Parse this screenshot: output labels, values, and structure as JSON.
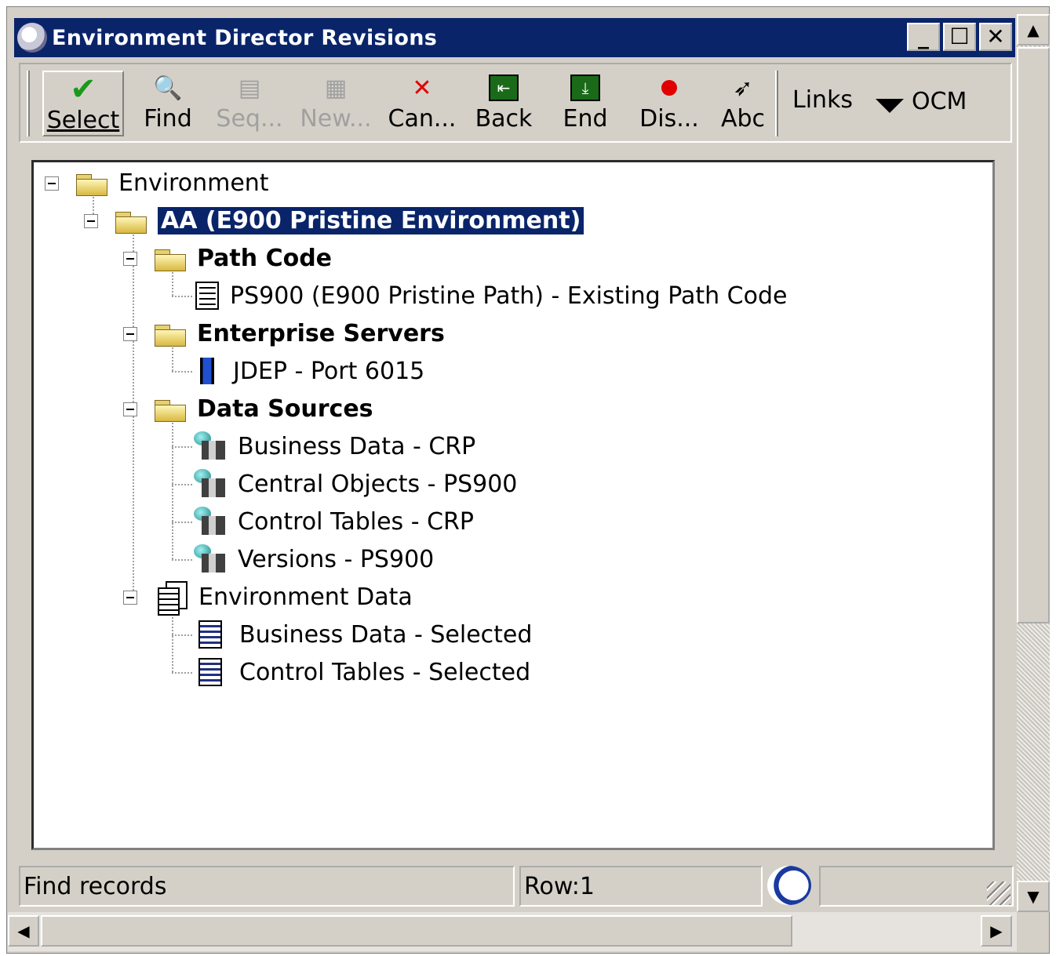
{
  "window": {
    "title": "Environment Director Revisions",
    "controls": {
      "minimize": "_",
      "maximize": "☐",
      "close": "✕"
    }
  },
  "toolbar": {
    "buttons": [
      {
        "label": "Select",
        "icon": "checkmark-icon",
        "enabled": true,
        "color": "#1a9a1a"
      },
      {
        "label": "Find",
        "icon": "find-icon",
        "enabled": true
      },
      {
        "label": "Seq...",
        "icon": "sequence-icon",
        "enabled": false
      },
      {
        "label": "New...",
        "icon": "new-icon",
        "enabled": false
      },
      {
        "label": "Can...",
        "icon": "cancel-x-icon",
        "enabled": true,
        "color": "#e00000"
      },
      {
        "label": "Back",
        "icon": "back-icon",
        "enabled": true
      },
      {
        "label": "End",
        "icon": "end-icon",
        "enabled": true
      },
      {
        "label": "Dis...",
        "icon": "display-icon",
        "enabled": true
      },
      {
        "label": "Abc",
        "icon": "abc-icon",
        "enabled": true
      }
    ],
    "links_label": "Links",
    "ocm_label": "OCM"
  },
  "tree": {
    "root": "Environment",
    "environment": "AA (E900 Pristine Environment)",
    "path_code_folder": "Path Code",
    "path_code_item": "PS900 (E900 Pristine Path) - Existing Path Code",
    "servers_folder": "Enterprise Servers",
    "server_item": "JDEP - Port 6015",
    "datasources_folder": "Data Sources",
    "datasources": [
      "Business Data - CRP",
      "Central Objects - PS900",
      "Control Tables - CRP",
      "Versions - PS900"
    ],
    "env_data_folder": "Environment Data",
    "env_data_items": [
      "Business Data - Selected",
      "Control Tables - Selected"
    ]
  },
  "status": {
    "message": "Find records",
    "row": "Row:1"
  },
  "colors": {
    "titlebar": "#0a246a",
    "selection": "#0a246a",
    "chrome": "#d4d0c8"
  }
}
